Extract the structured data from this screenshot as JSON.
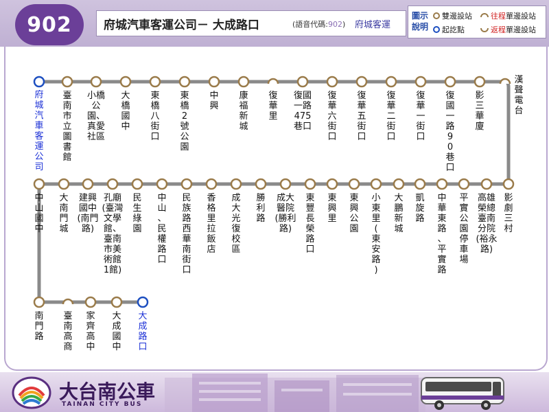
{
  "header": {
    "route_number": "902",
    "title": "府城汽車客運公司－ 大成路口",
    "voice_code_prefix": "(語音代碼:",
    "voice_code_number": "902",
    "voice_code_suffix": ")",
    "operator": "府城客運",
    "legend": {
      "title": "圖示說明",
      "both_ways": "雙邊設站",
      "outbound_prefix": "往程",
      "outbound_suffix": "單邊設站",
      "start": "起訖點",
      "return_prefix": "返程",
      "return_suffix": "單邊設站"
    }
  },
  "colors": {
    "route_line": "#8a8a8a",
    "stop_ring": "#9a7b4a",
    "terminal_ring": "#1d4fc0",
    "brand": "#6b3f98",
    "terminal_text": "#1a2fd6"
  },
  "stops": [
    {
      "name": "府城汽車客運公司",
      "type": "terminal"
    },
    {
      "name": "臺南市立圖書館",
      "type": "both"
    },
    {
      "name": "小橋公園、真愛社區",
      "type": "both"
    },
    {
      "name": "大橋國中",
      "type": "both"
    },
    {
      "name": "東橋八街口",
      "type": "both"
    },
    {
      "name": "東橋2號公園",
      "type": "both"
    },
    {
      "name": "中興",
      "type": "both"
    },
    {
      "name": "康福新城",
      "type": "both"
    },
    {
      "name": "復華里",
      "type": "outbound"
    },
    {
      "name": "復國一路475巷口",
      "type": "both"
    },
    {
      "name": "復華六街口",
      "type": "both"
    },
    {
      "name": "復華五街口",
      "type": "both"
    },
    {
      "name": "復華二街口",
      "type": "both"
    },
    {
      "name": "復華一街口",
      "type": "both"
    },
    {
      "name": "復國一路90巷口",
      "type": "both"
    },
    {
      "name": "影三華廈",
      "type": "both"
    },
    {
      "name": "漢聲電台",
      "type": "outbound"
    },
    {
      "name": "影劇三村",
      "type": "both"
    },
    {
      "name": "高雄榮總臺南分院(裕永路)",
      "type": "both"
    },
    {
      "name": "平實公園停車場",
      "type": "both"
    },
    {
      "name": "中華東路、平實路",
      "type": "both"
    },
    {
      "name": "凱旋路",
      "type": "both"
    },
    {
      "name": "大鵬新城",
      "type": "both"
    },
    {
      "name": "小東里(東安路)",
      "type": "both"
    },
    {
      "name": "東興公園",
      "type": "both"
    },
    {
      "name": "東興里",
      "type": "both"
    },
    {
      "name": "東豐長榮路口",
      "type": "both"
    },
    {
      "name": "成大醫院(勝利路)",
      "type": "both"
    },
    {
      "name": "勝利路",
      "type": "both"
    },
    {
      "name": "成大光復校區",
      "type": "both"
    },
    {
      "name": "香格里拉飯店",
      "type": "both"
    },
    {
      "name": "民族路西華南街口",
      "type": "both"
    },
    {
      "name": "中山、民權路口",
      "type": "both"
    },
    {
      "name": "民生綠園",
      "type": "both"
    },
    {
      "name": "孔廟(臺灣文學館、臺南市美術館1館)",
      "type": "both"
    },
    {
      "name": "建興國中(南門路)",
      "type": "both"
    },
    {
      "name": "大南門城",
      "type": "both"
    },
    {
      "name": "中山國中",
      "type": "both"
    },
    {
      "name": "南門路",
      "type": "both"
    },
    {
      "name": "臺南高商",
      "type": "outbound"
    },
    {
      "name": "家齊高中",
      "type": "both"
    },
    {
      "name": "大成國中",
      "type": "both"
    },
    {
      "name": "大成路口",
      "type": "terminal"
    }
  ],
  "footer": {
    "brand_name": "大台南公車",
    "brand_sub": "TAINAN CITY BUS"
  }
}
